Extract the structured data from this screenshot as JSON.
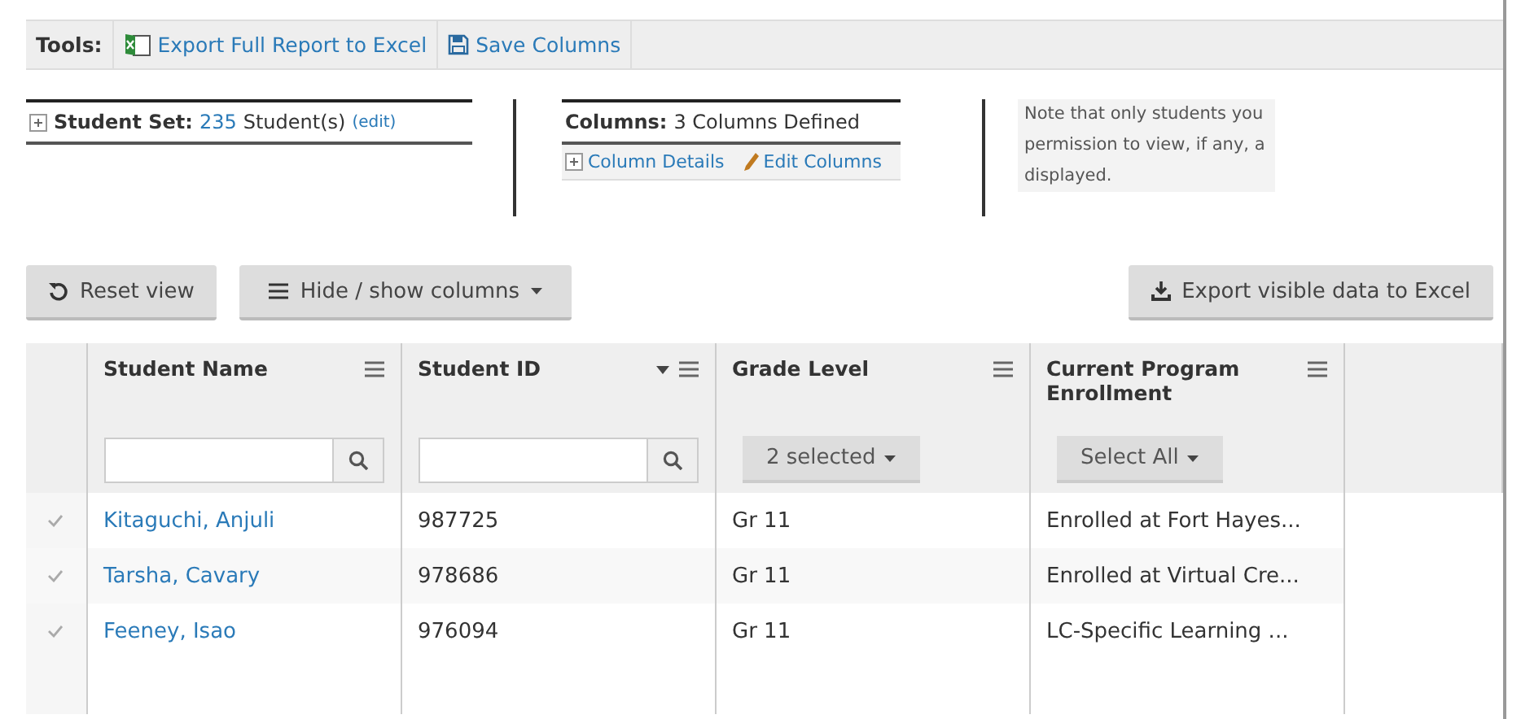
{
  "toolbar": {
    "label": "Tools:",
    "items": [
      {
        "kind": "excel",
        "label": "Export Full Report to Excel"
      },
      {
        "kind": "save",
        "label": "Save Columns"
      }
    ]
  },
  "student_set": {
    "label": "Student Set:",
    "count": "235",
    "unit": "Student(s)",
    "edit": "(edit)"
  },
  "columns_info": {
    "label": "Columns:",
    "value": "3 Columns Defined",
    "details": "Column Details",
    "edit": "Edit Columns"
  },
  "note_lines": [
    "Note that only students you",
    "permission to view, if any, a",
    "displayed."
  ],
  "actions": {
    "reset": "Reset view",
    "hide_show": "Hide / show columns",
    "export": "Export visible data to Excel"
  },
  "table": {
    "columns": [
      {
        "title": "Student Name",
        "sorted": false,
        "filter": {
          "kind": "text"
        }
      },
      {
        "title": "Student ID",
        "sorted": true,
        "filter": {
          "kind": "text"
        }
      },
      {
        "title": "Grade Level",
        "sorted": false,
        "filter": {
          "kind": "dropdown",
          "label": "2 selected"
        }
      },
      {
        "title": "Current Program Enrollment",
        "sorted": false,
        "filter": {
          "kind": "dropdown",
          "label": "Select All"
        }
      }
    ],
    "rows": [
      [
        "Kitaguchi, Anjuli",
        "987725",
        "Gr 11",
        "Enrolled at Fort Hayes..."
      ],
      [
        "Tarsha, Cavary",
        "978686",
        "Gr 11",
        "Enrolled at Virtual Cre..."
      ],
      [
        "Feeney, Isao",
        "976094",
        "Gr 11",
        "LC-Specific Learning ..."
      ]
    ]
  }
}
